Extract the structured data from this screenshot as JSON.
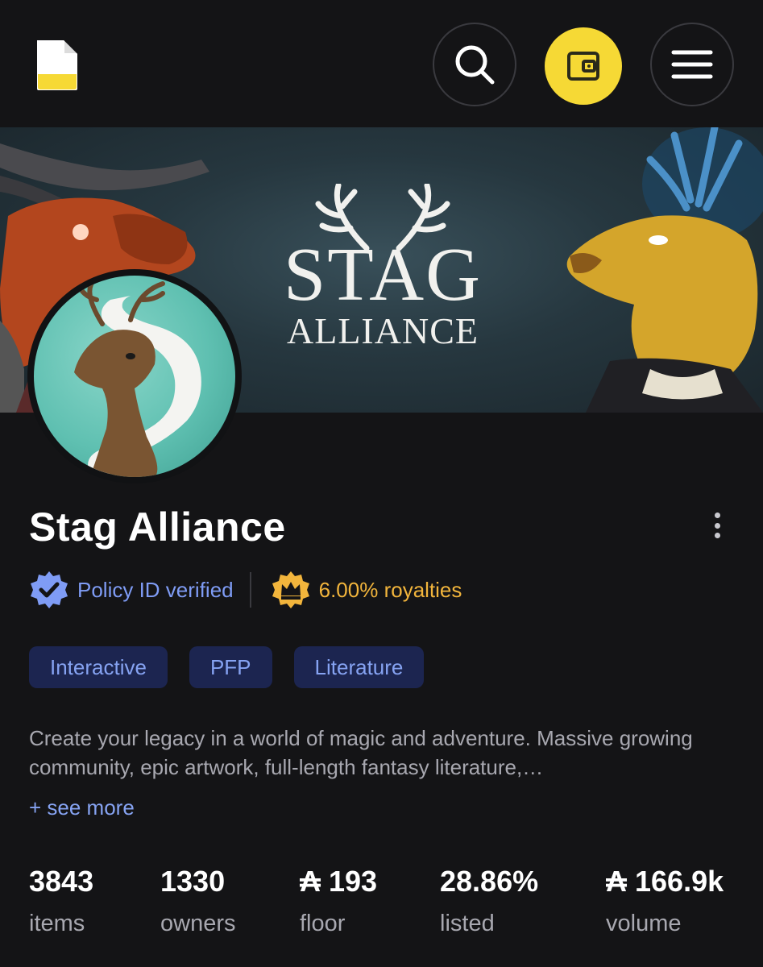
{
  "header": {
    "logo_icon": "document-icon",
    "search_icon": "search-icon",
    "wallet_icon": "wallet-icon",
    "menu_icon": "hamburger-icon",
    "wallet_color": "#f6d935"
  },
  "banner": {
    "title": "STAG",
    "subtitle": "ALLIANCE"
  },
  "collection": {
    "name": "Stag Alliance",
    "verified_label": "Policy ID verified",
    "royalties_label": "6.00% royalties",
    "tags": [
      "Interactive",
      "PFP",
      "Literature"
    ],
    "description": "Create your legacy in a world of magic and adventure. Massive growing community, epic artwork, full-length fantasy literature,…",
    "see_more": "+ see more"
  },
  "stats": [
    {
      "value": "3843",
      "label": "items"
    },
    {
      "value": "1330",
      "label": "owners"
    },
    {
      "value": "₳ 193",
      "label": "floor"
    },
    {
      "value": "28.86%",
      "label": "listed"
    },
    {
      "value": "₳ 166.9k",
      "label": "volume"
    }
  ],
  "colors": {
    "background": "#141416",
    "accent_blue": "#86a3f2",
    "accent_gold": "#f2b53c",
    "tag_bg": "#1c2550"
  }
}
